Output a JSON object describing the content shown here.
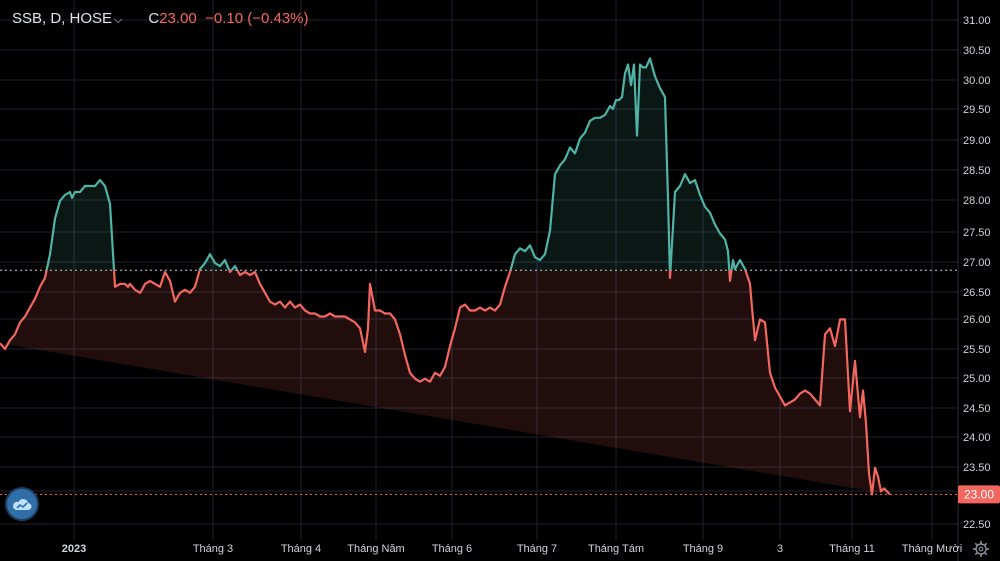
{
  "header": {
    "symbol": "SSB, D, HOSE",
    "close_label": "C",
    "close_value": "23.00",
    "change": "−0.10 (−0.43%)"
  },
  "colors": {
    "background": "#000000",
    "up_line": "#4fb3a6",
    "down_line": "#f4675f",
    "grid": "#1e222d",
    "axis_text": "#d1d4dc",
    "price_tag": "#f4675f"
  },
  "icons": {
    "logo": "tradingview-cloud-icon",
    "settings": "gear-icon"
  },
  "chart_data": {
    "type": "area",
    "baseline": 26.78,
    "last_price_label": "23.00",
    "ylim": [
      22.3,
      31.3
    ],
    "y_ticks": [
      "31.00",
      "30.50",
      "30.00",
      "29.50",
      "29.00",
      "28.50",
      "28.00",
      "27.50",
      "27.00",
      "26.50",
      "26.00",
      "25.50",
      "25.00",
      "24.50",
      "24.00",
      "23.50",
      "23.00",
      "22.50"
    ],
    "x_ticks": [
      "2023",
      "Tháng 3",
      "Tháng 4",
      "Tháng Năm",
      "Tháng 6",
      "Tháng 7",
      "Tháng Tám",
      "Tháng 9",
      "3",
      "Tháng 11",
      "Tháng Mười"
    ],
    "x": [
      0,
      5,
      10,
      15,
      20,
      25,
      30,
      35,
      40,
      45,
      50,
      55,
      60,
      65,
      70,
      72,
      75,
      80,
      85,
      90,
      95,
      100,
      105,
      110,
      115,
      120,
      125,
      128,
      130,
      135,
      140,
      142,
      145,
      150,
      155,
      160,
      165,
      170,
      175,
      180,
      185,
      190,
      195,
      200,
      205,
      210,
      215,
      220,
      225,
      230,
      235,
      240,
      245,
      250,
      255,
      260,
      265,
      270,
      275,
      280,
      285,
      290,
      295,
      300,
      305,
      310,
      315,
      320,
      325,
      330,
      335,
      340,
      345,
      350,
      355,
      360,
      365,
      368,
      370,
      375,
      380,
      385,
      390,
      395,
      400,
      405,
      410,
      415,
      420,
      425,
      430,
      435,
      440,
      445,
      450,
      455,
      460,
      465,
      470,
      475,
      480,
      485,
      490,
      495,
      500,
      505,
      510,
      515,
      520,
      525,
      530,
      535,
      540,
      545,
      550,
      555,
      560,
      565,
      570,
      575,
      580,
      585,
      590,
      595,
      600,
      605,
      610,
      613,
      616,
      619,
      622,
      625,
      628,
      631,
      634,
      637,
      640,
      643,
      646,
      650,
      655,
      660,
      665,
      668,
      670,
      675,
      680,
      685,
      690,
      695,
      700,
      705,
      710,
      715,
      720,
      725,
      728,
      730,
      733,
      735,
      740,
      745,
      750,
      752,
      755,
      760,
      765,
      770,
      775,
      780,
      785,
      790,
      795,
      800,
      805,
      810,
      815,
      820,
      825,
      830,
      835,
      840,
      845,
      850,
      855,
      860,
      863,
      866,
      869,
      872,
      875,
      878,
      881,
      884,
      887,
      890,
      895,
      900,
      905,
      910,
      915,
      918
    ],
    "values": [
      25.55,
      25.45,
      25.6,
      25.7,
      25.9,
      26.0,
      26.15,
      26.3,
      26.5,
      26.65,
      27.05,
      27.65,
      27.95,
      28.05,
      28.1,
      28.0,
      28.1,
      28.1,
      28.2,
      28.2,
      28.2,
      28.3,
      28.2,
      27.9,
      26.5,
      26.55,
      26.55,
      26.5,
      26.55,
      26.45,
      26.4,
      26.45,
      26.55,
      26.6,
      26.55,
      26.5,
      26.75,
      26.6,
      26.25,
      26.4,
      26.45,
      26.4,
      26.5,
      26.8,
      26.9,
      27.05,
      26.9,
      26.85,
      26.95,
      26.75,
      26.85,
      26.7,
      26.75,
      26.7,
      26.75,
      26.55,
      26.4,
      26.25,
      26.2,
      26.25,
      26.15,
      26.25,
      26.15,
      26.2,
      26.1,
      26.05,
      26.05,
      26.0,
      26.0,
      26.05,
      26.0,
      26.0,
      26.0,
      25.95,
      25.9,
      25.8,
      25.4,
      25.8,
      26.55,
      26.1,
      26.1,
      26.05,
      26.05,
      25.95,
      25.7,
      25.35,
      25.05,
      24.95,
      24.9,
      24.95,
      24.9,
      25.05,
      25.0,
      25.15,
      25.5,
      25.8,
      26.15,
      26.2,
      26.1,
      26.1,
      26.15,
      26.1,
      26.15,
      26.1,
      26.2,
      26.5,
      26.75,
      27.05,
      27.15,
      27.1,
      27.2,
      27.0,
      26.95,
      27.05,
      27.45,
      28.4,
      28.55,
      28.65,
      28.85,
      28.75,
      29.0,
      29.1,
      29.3,
      29.35,
      29.35,
      29.4,
      29.55,
      29.5,
      29.65,
      29.65,
      29.7,
      30.1,
      30.25,
      29.9,
      30.25,
      29.05,
      30.25,
      30.2,
      30.2,
      30.35,
      30.05,
      29.85,
      29.7,
      28.0,
      26.65,
      28.1,
      28.2,
      28.4,
      28.25,
      28.3,
      28.05,
      27.85,
      27.75,
      27.55,
      27.4,
      27.3,
      27.1,
      26.6,
      26.95,
      26.8,
      26.95,
      26.8,
      26.55,
      26.15,
      25.6,
      25.95,
      25.9,
      25.05,
      24.8,
      24.65,
      24.5,
      24.55,
      24.6,
      24.7,
      24.75,
      24.7,
      24.6,
      24.5,
      25.7,
      25.8,
      25.5,
      25.95,
      25.95,
      24.4,
      25.25,
      24.3,
      24.75,
      24.2,
      23.35,
      23.0,
      23.45,
      23.3,
      23.05,
      23.1,
      23.05,
      23.0
    ]
  }
}
